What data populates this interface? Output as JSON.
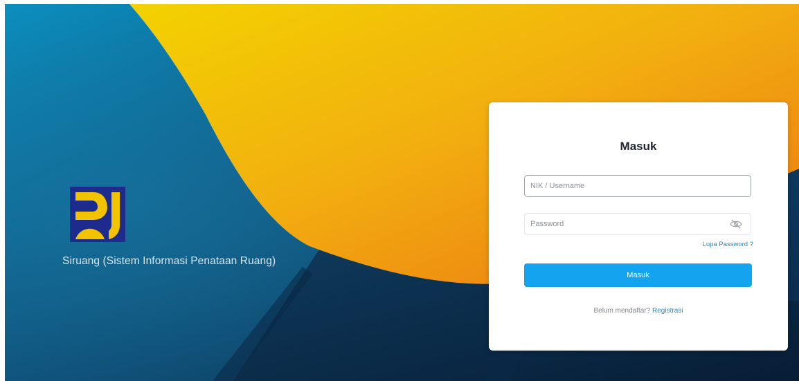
{
  "app": {
    "title": "Siruang (Sistem Informasi Penataan Ruang)"
  },
  "login": {
    "heading": "Masuk",
    "username_placeholder": "NIK / Username",
    "password_placeholder": "Password",
    "forgot_link": "Lupa Password ?",
    "submit_label": "Masuk",
    "register_prompt": "Belum mendaftar?",
    "register_link": "Registrasi"
  },
  "icons": {
    "password_toggle": "eye-slash-icon",
    "logo": "pu-logo-icon"
  },
  "colors": {
    "accent": "#14a3ee",
    "link": "#1a8ccc",
    "logo_yellow": "#f2c400",
    "logo_blue": "#1d2b8c"
  }
}
